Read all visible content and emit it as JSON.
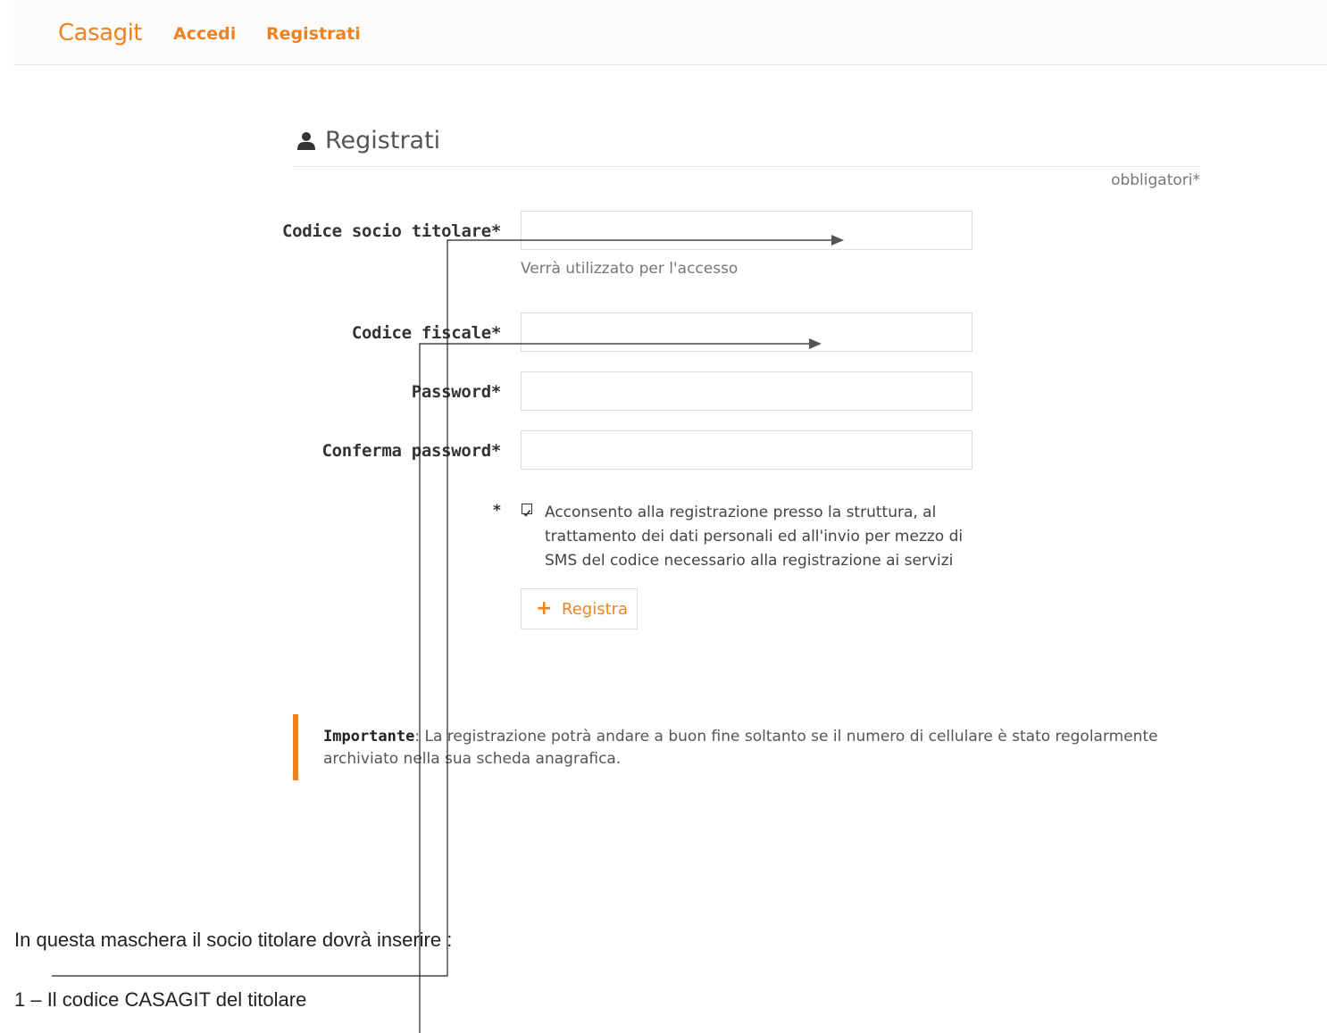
{
  "navbar": {
    "brand": "Casagit",
    "links": [
      {
        "label": "Accedi"
      },
      {
        "label": "Registrati"
      }
    ]
  },
  "page": {
    "title": "Registrati",
    "required_note": "obbligatori*"
  },
  "form": {
    "fields": [
      {
        "label": "Codice socio titolare*",
        "value": "",
        "hint": "Verrà utilizzato per l'accesso"
      },
      {
        "label": "Codice fiscale*",
        "value": ""
      },
      {
        "label": "Password*",
        "value": ""
      },
      {
        "label": "Conferma password*",
        "value": ""
      }
    ],
    "consent": {
      "required_mark": "*",
      "checked": true,
      "text": "Acconsento alla registrazione presso la struttura, al trattamento dei dati personali ed all'invio per mezzo di SMS del codice necessario alla registrazione ai servizi"
    },
    "submit": {
      "label": "Registra"
    }
  },
  "notice": {
    "strong": "Importante",
    "text": ": La registrazione potrà andare a buon fine soltanto se il numero di cellulare è stato regolarmente archiviato nella sua scheda anagrafica."
  },
  "document": {
    "intro": "In questa maschera il socio titolare dovrà inserire :",
    "item1": "1 – Il codice CASAGIT del titolare"
  },
  "colors": {
    "accent": "#f0821e",
    "text": "#333333",
    "border": "#dddddd"
  },
  "icons": [
    "user-icon",
    "checkbox-checked-icon",
    "plus-icon"
  ]
}
